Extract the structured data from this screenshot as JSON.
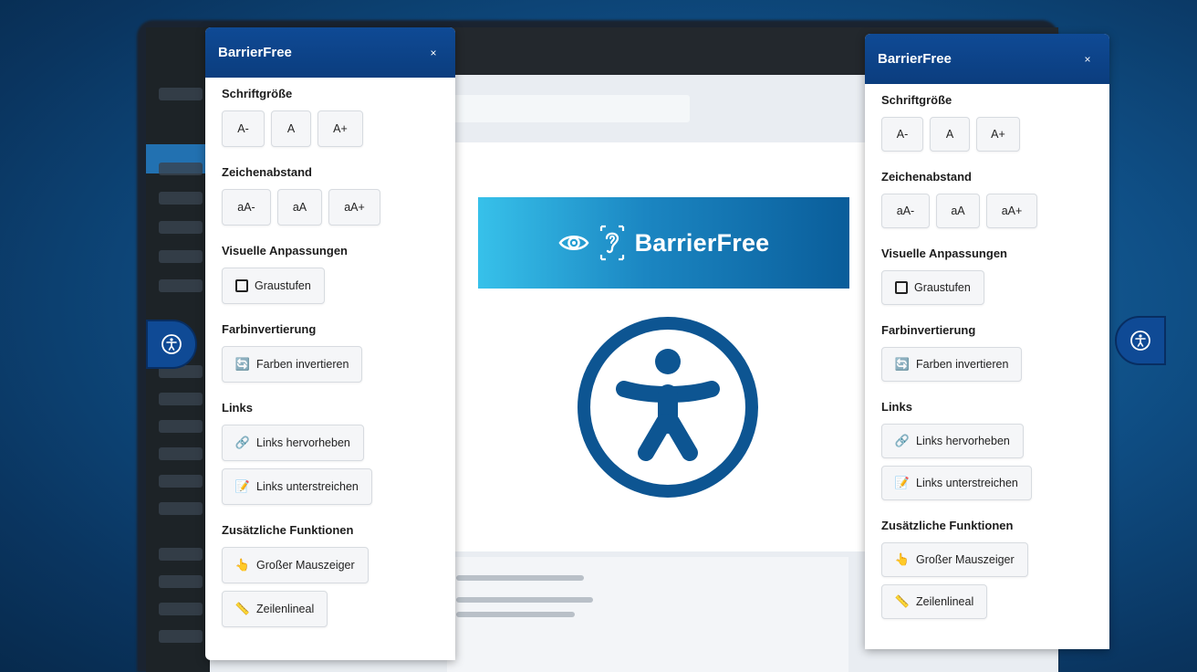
{
  "colors": {
    "panel_header": "#0f4a95",
    "banner_start": "#37c1ea",
    "banner_end": "#0a5d9a",
    "symbol_blue": "#0d5592"
  },
  "banner": {
    "brand": "BarrierFree",
    "icons": [
      "eye-icon",
      "ear-icon"
    ]
  },
  "panel_left": {
    "title": "BarrierFree",
    "close": "×",
    "sections": {
      "font_size": {
        "title": "Schriftgröße",
        "buttons": [
          "A-",
          "A",
          "A+"
        ]
      },
      "letter_spacing": {
        "title": "Zeichenabstand",
        "buttons": [
          "aA-",
          "aA",
          "aA+"
        ]
      },
      "visual": {
        "title": "Visuelle Anpassungen",
        "grayscale": "Graustufen"
      },
      "invert": {
        "title": "Farbinvertierung",
        "invert_colors": "Farben invertieren"
      },
      "links": {
        "title": "Links",
        "highlight": "Links hervorheben",
        "underline": "Links unterstreichen"
      },
      "extra": {
        "title": "Zusätzliche Funktionen",
        "cursor": "Großer Mauszeiger",
        "ruler": "Zeilenlineal"
      }
    }
  },
  "panel_right": {
    "title": "BarrierFree",
    "close": "×",
    "sections": {
      "font_size": {
        "title": "Schriftgröße",
        "buttons": [
          "A-",
          "A",
          "A+"
        ]
      },
      "letter_spacing": {
        "title": "Zeichenabstand",
        "buttons": [
          "aA-",
          "aA",
          "aA+"
        ]
      },
      "visual": {
        "title": "Visuelle Anpassungen",
        "grayscale": "Graustufen"
      },
      "invert": {
        "title": "Farbinvertierung",
        "invert_colors": "Farben invertieren"
      },
      "links": {
        "title": "Links",
        "highlight": "Links hervorheben",
        "underline": "Links unterstreichen"
      },
      "extra": {
        "title": "Zusätzliche Funktionen",
        "cursor": "Großer Mauszeiger",
        "ruler": "Zeilenlineal"
      }
    }
  }
}
